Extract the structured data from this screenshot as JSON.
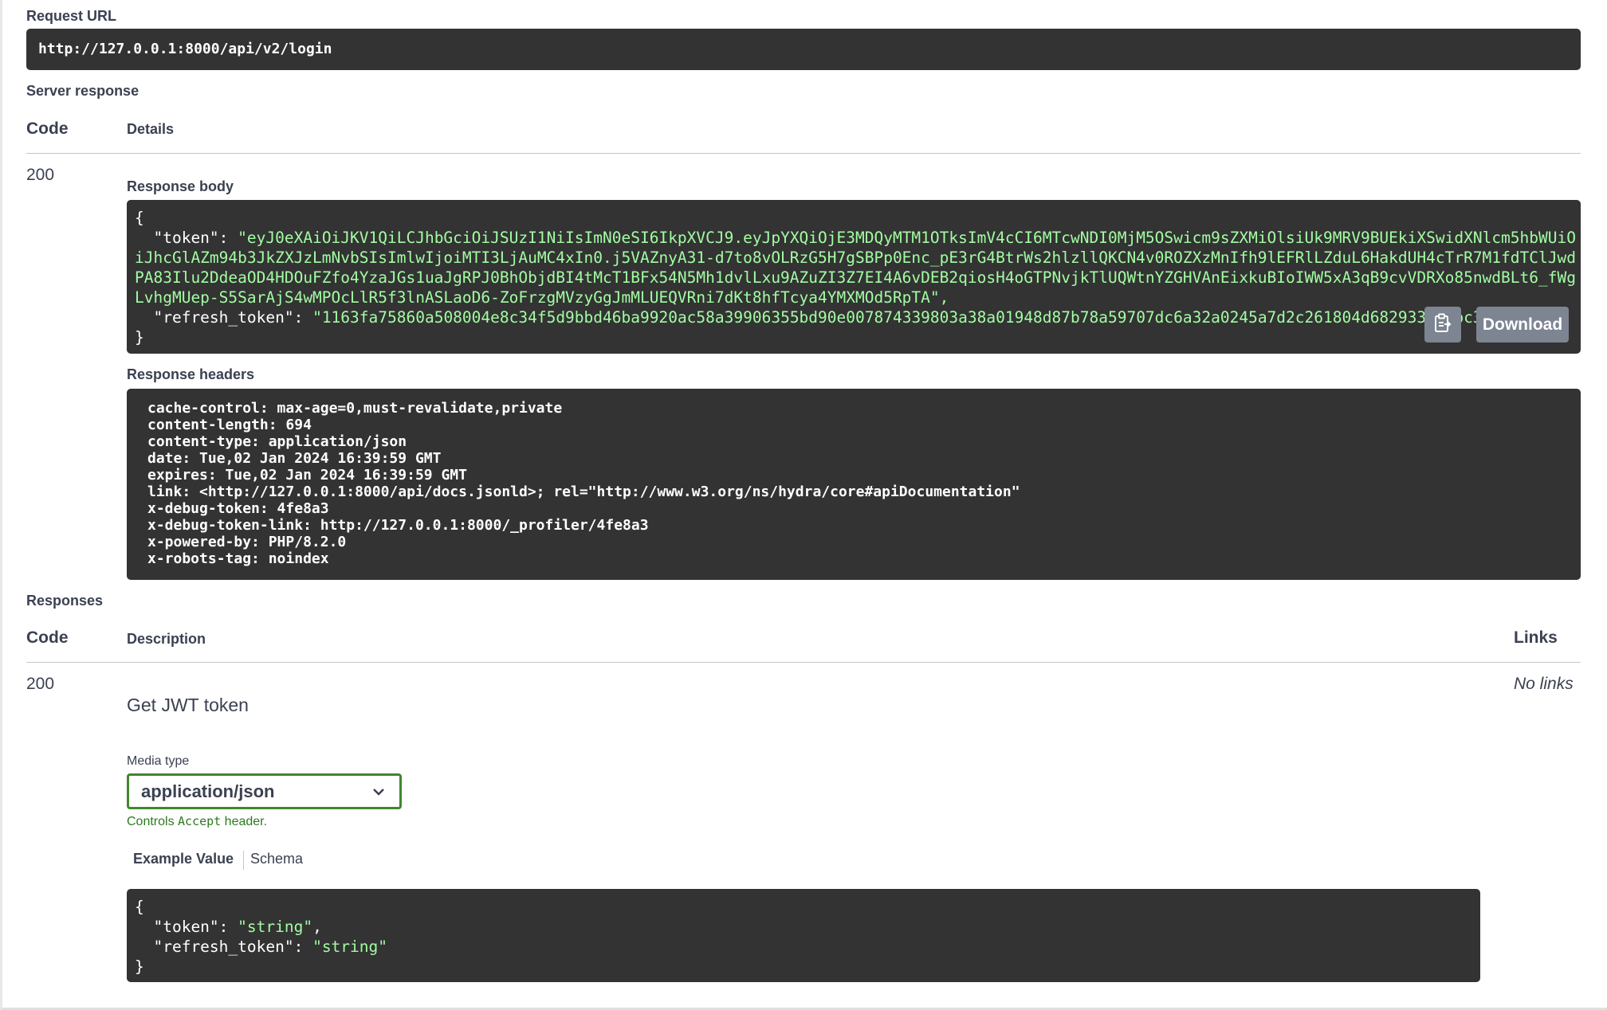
{
  "request_url": {
    "label": "Request URL",
    "value": "http://127.0.0.1:8000/api/v2/login"
  },
  "server_response": {
    "label": "Server response",
    "columns": {
      "code": "Code",
      "details": "Details"
    },
    "code": "200",
    "response_body": {
      "label": "Response body",
      "open_brace": "{",
      "close_brace": "}",
      "token_key": "\"token\": ",
      "token_value": "\"eyJ0eXAiOiJKV1QiLCJhbGciOiJSUzI1NiIsImN0eSI6IkpXVCJ9.eyJpYXQiOjE3MDQyMTM1OTksImV4cCI6MTcwNDI0MjM5OSwicm9sZXMiOlsiUk9MRV9BUEkiXSwidXNlcm5hbWUiOiJhcGlAZm94b3JkZXJzLmNvbSIsImlwIjoiMTI3LjAuMC4xIn0.j5VAZnyA31-d7to8vOLRzG5H7gSBPp0Enc_pE3rG4BtrWs2hlzllQKCN4v0ROZXzMnIfh9lEFRlLZduL6HakdUH4cTrR7M1fdTClJwdPA83Ilu2DdeaOD4HDOuFZfo4YzaJGs1uaJgRPJ0BhObjdBI4tMcT1BFx54N5Mh1dvlLxu9AZuZI3Z7EI4A6vDEB2qiosH4oGTPNvjkTlUQWtnYZGHVAnEixkuBIoIWW5xA3qB9cvVDRXo85nwdBLt6_fWgLvhgMUep-S5SarAjS4wMPOcLlR5f3lnASLaoD6-ZoFrzgMVzyGgJmMLUEQVRni7dKt8hfTcya4YMXMOd5RpTA\",",
      "refresh_key": "\"refresh_token\": ",
      "refresh_value": "\"1163fa75860a508004e8c34f5d9bbd46ba9920ac58a39906355bd90e007874339803a38a01948d87b78a59707dc6a32a0245a7d2c261804d682933cdbbc3be8c\"",
      "copy_icon": "clipboard-icon",
      "download_label": "Download"
    },
    "response_headers": {
      "label": "Response headers",
      "lines": [
        "cache-control: max-age=0,must-revalidate,private",
        "content-length: 694",
        "content-type: application/json",
        "date: Tue,02 Jan 2024 16:39:59 GMT",
        "expires: Tue,02 Jan 2024 16:39:59 GMT",
        "link: <http://127.0.0.1:8000/api/docs.jsonld>; rel=\"http://www.w3.org/ns/hydra/core#apiDocumentation\"",
        "x-debug-token: 4fe8a3",
        "x-debug-token-link: http://127.0.0.1:8000/_profiler/4fe8a3",
        "x-powered-by: PHP/8.2.0",
        "x-robots-tag: noindex"
      ]
    }
  },
  "responses": {
    "label": "Responses",
    "columns": {
      "code": "Code",
      "description": "Description",
      "links": "Links"
    },
    "code": "200",
    "description": "Get JWT token",
    "links": "No links",
    "media_type": {
      "label": "Media type",
      "selected": "application/json",
      "icon": "chevron-down-icon",
      "controls_pre": "Controls ",
      "controls_kw": "Accept",
      "controls_post": " header."
    },
    "tabs": [
      "Example Value",
      "Schema"
    ],
    "example": {
      "open_brace": "{",
      "close_brace": "}",
      "token_key": "\"token\": ",
      "token_value": "\"string\"",
      "comma": ",",
      "refresh_key": "\"refresh_token\": ",
      "refresh_value": "\"string\""
    }
  },
  "colors": {
    "code_background": "#333333",
    "json_string": "#a2fca2",
    "accent_green": "#41862e",
    "button_gray": "#7d8492",
    "text": "#3b4151"
  }
}
